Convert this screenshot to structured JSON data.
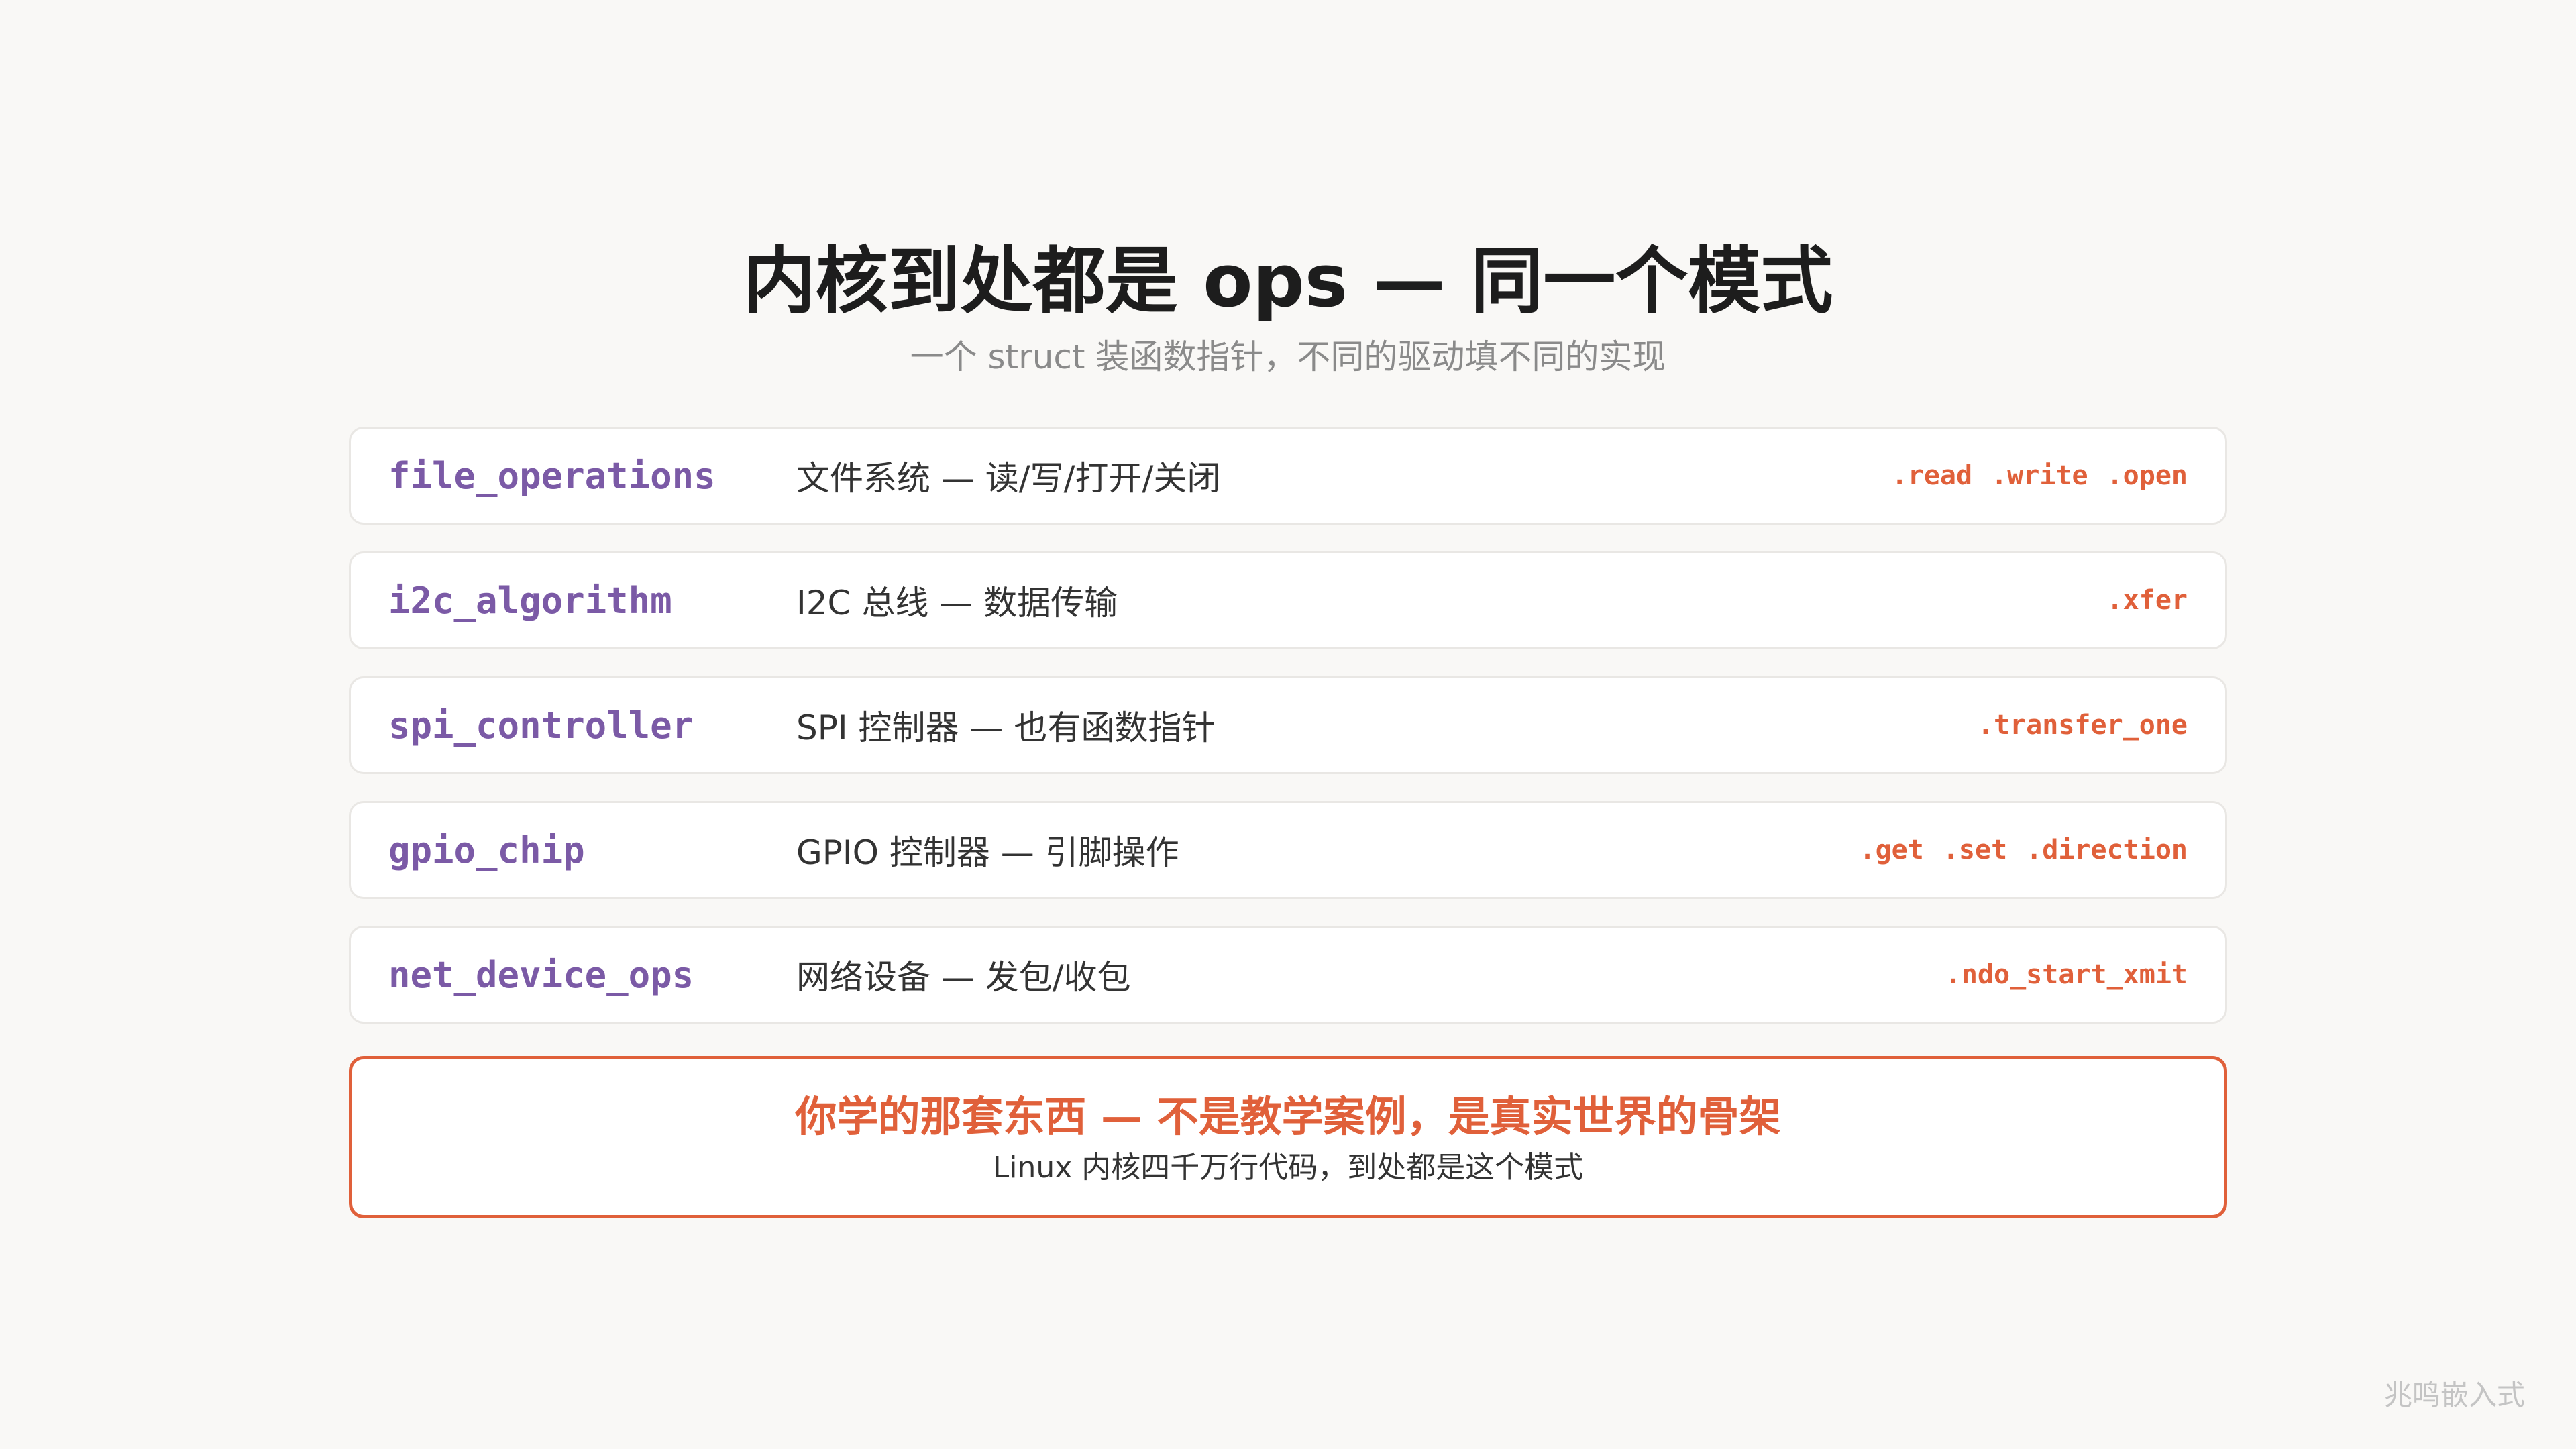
{
  "title": "内核到处都是 ops — 同一个模式",
  "subtitle": "一个 struct 装函数指针，不同的驱动填不同的实现",
  "rows": [
    {
      "name": "file_operations",
      "description": "文件系统 — 读/写/打开/关闭",
      "methods": [
        ".read",
        ".write",
        ".open"
      ]
    },
    {
      "name": "i2c_algorithm",
      "description": "I2C 总线 — 数据传输",
      "methods": [
        ".xfer"
      ]
    },
    {
      "name": "spi_controller",
      "description": "SPI 控制器 — 也有函数指针",
      "methods": [
        ".transfer_one"
      ]
    },
    {
      "name": "gpio_chip",
      "description": "GPIO 控制器 — 引脚操作",
      "methods": [
        ".get",
        ".set",
        ".direction"
      ]
    },
    {
      "name": "net_device_ops",
      "description": "网络设备 — 发包/收包",
      "methods": [
        ".ndo_start_xmit"
      ]
    }
  ],
  "callout": {
    "title": "你学的那套东西 — 不是教学案例，是真实世界的骨架",
    "subtitle": "Linux 内核四千万行代码，到处都是这个模式"
  },
  "watermark": "兆鸣嵌入式",
  "colors": {
    "background": "#f9f8f6",
    "title": "#1d1d1d",
    "struct_name": "#7b5aa6",
    "method": "#e0603a",
    "accent_border": "#e0603a"
  }
}
